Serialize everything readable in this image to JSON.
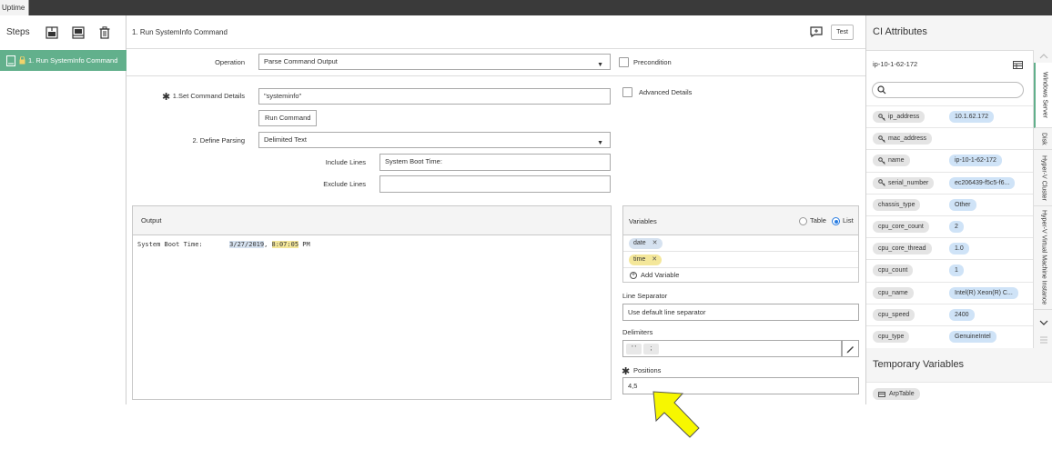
{
  "window_tab": "Uptime",
  "steps": {
    "title": "Steps",
    "items": [
      {
        "label": "1.  Run SystemInfo Command"
      }
    ]
  },
  "editor": {
    "title": "1. Run SystemInfo Command",
    "test_label": "Test",
    "operation_label": "Operation",
    "operation_value": "Parse Command Output",
    "precondition_label": "Precondition",
    "set_command_label": "1.Set Command Details",
    "command_value": "\"systeminfo\"",
    "advanced_details_label": "Advanced Details",
    "run_command_label": "Run Command",
    "define_parsing_label": "2. Define Parsing",
    "parsing_value": "Delimited Text",
    "include_lines_label": "Include Lines",
    "include_lines_value": "System Boot Time:",
    "exclude_lines_label": "Exclude Lines",
    "exclude_lines_value": ""
  },
  "output": {
    "title": "Output",
    "prefix": "System Boot Time:       ",
    "date": "3/27/2019",
    "sep": ", ",
    "time": "8:07:05",
    "suffix": " PM"
  },
  "variables": {
    "title": "Variables",
    "table_label": "Table",
    "list_label": "List",
    "selected_view": "List",
    "items": [
      {
        "name": "date",
        "color": "#d6e2f0"
      },
      {
        "name": "time",
        "color": "#f4e79a"
      }
    ],
    "add_label": "Add Variable"
  },
  "line_separator": {
    "label": "Line Separator",
    "value": "Use default line separator"
  },
  "delimiters": {
    "label": "Delimiters",
    "items": [
      "' '",
      ";"
    ]
  },
  "positions": {
    "label": "Positions",
    "value": "4,5"
  },
  "ci_attributes": {
    "title": "CI Attributes",
    "host": "ip-10-1-62-172",
    "search_placeholder": "",
    "rows": [
      {
        "key": "ip_address",
        "value": "10.1.62.172",
        "linked": true
      },
      {
        "key": "mac_address",
        "value": "",
        "linked": true
      },
      {
        "key": "name",
        "value": "ip-10-1-62-172",
        "linked": true
      },
      {
        "key": "serial_number",
        "value": "ec206439-f5c5-f6...",
        "linked": true
      },
      {
        "key": "chassis_type",
        "value": "Other",
        "linked": false
      },
      {
        "key": "cpu_core_count",
        "value": "2",
        "linked": false
      },
      {
        "key": "cpu_core_thread",
        "value": "1.0",
        "linked": false
      },
      {
        "key": "cpu_count",
        "value": "1",
        "linked": false
      },
      {
        "key": "cpu_name",
        "value": "Intel(R) Xeon(R) C...",
        "linked": false
      },
      {
        "key": "cpu_speed",
        "value": "2400",
        "linked": false
      },
      {
        "key": "cpu_type",
        "value": "GenuineIntel",
        "linked": false
      }
    ],
    "tabs": [
      "Windows Server",
      "Disk",
      "Hyper-V Cluster",
      "Hyper-V Virtual Machine Instance"
    ],
    "active_tab": "Windows Server"
  },
  "temporary_variables": {
    "title": "Temporary Variables",
    "items": [
      "ArpTable"
    ]
  },
  "colors": {
    "accent_green": "#62b08c",
    "chip_blue": "#cfe3f7",
    "highlight_yellow": "#f4e79a",
    "arrow_yellow": "#f7f700"
  }
}
